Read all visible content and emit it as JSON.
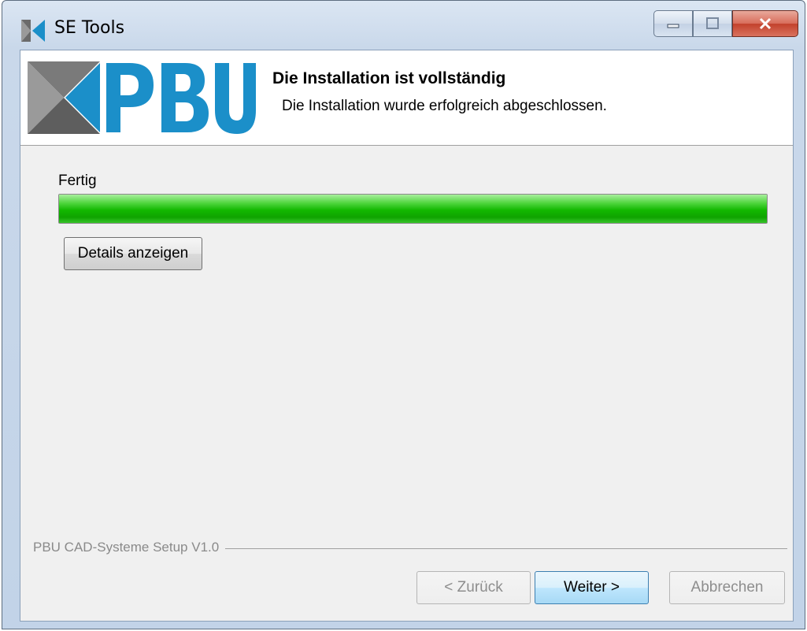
{
  "window": {
    "title": "SE Tools",
    "minimize_icon": "minimize-icon",
    "maximize_icon": "maximize-icon",
    "close_icon": "close-icon"
  },
  "header": {
    "logo_text": "PBU",
    "title": "Die Installation ist vollständig",
    "subtitle": "Die Installation wurde erfolgreich abgeschlossen."
  },
  "progress": {
    "label": "Fertig",
    "fraction": 1.0,
    "color": "#12b800"
  },
  "buttons": {
    "details": "Details anzeigen",
    "back": "< Zurück",
    "next": "Weiter >",
    "cancel": "Abbrechen"
  },
  "footer": {
    "brand": "PBU CAD-Systeme Setup V1.0"
  },
  "colors": {
    "logo_blue": "#1b8fc9",
    "logo_gray": "#6b6b6b"
  }
}
